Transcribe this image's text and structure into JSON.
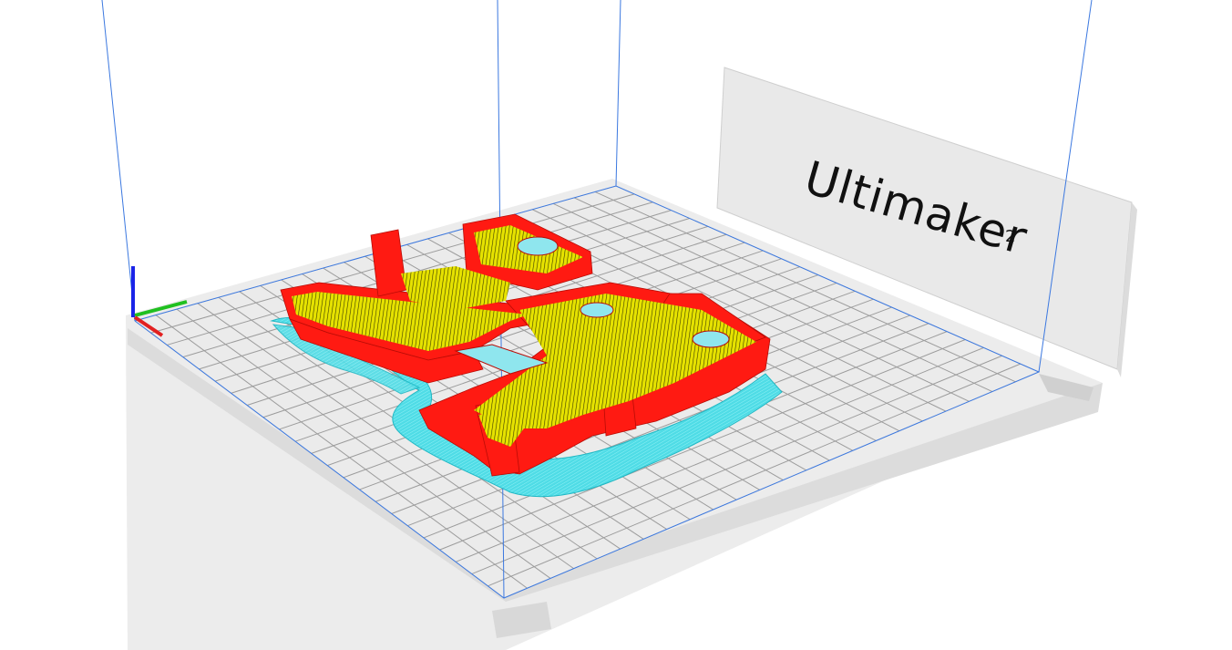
{
  "app": {
    "view": "layer-view"
  },
  "printer": {
    "brand_label": "Ultimaker",
    "model_superscript": "2"
  },
  "colors": {
    "background": "#ffffff",
    "buildplate": "#e4e4e4",
    "grid_line": "#9c9c9c",
    "build_volume_line": "#3b78e0",
    "wall": "#ff1a12",
    "infill": "#e6e200",
    "support": "#4fdce6",
    "axis_x": "#e22020",
    "axis_y": "#20c020",
    "axis_z": "#1a24e8"
  },
  "scene": {
    "axes": [
      "x-axis",
      "y-axis",
      "z-axis"
    ],
    "legend": []
  }
}
